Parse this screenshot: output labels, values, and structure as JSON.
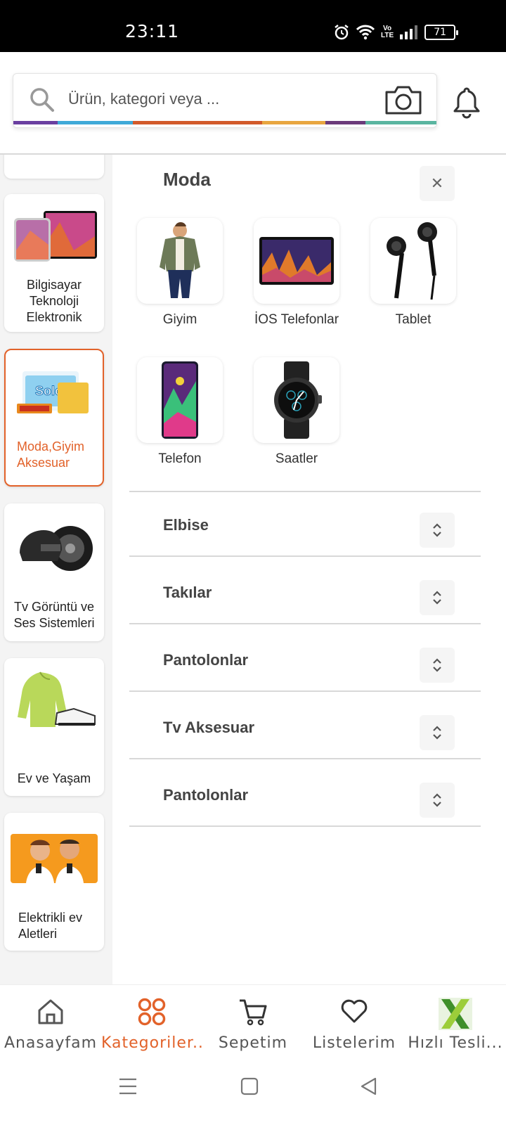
{
  "status_bar": {
    "time": "23:11",
    "battery": "71",
    "network": "Vo LTE"
  },
  "search": {
    "placeholder": "Ürün, kategori veya ..."
  },
  "rainbow_colors": [
    "#6a3fa0",
    "#3fa9d8",
    "#d25a2a",
    "#e8a640",
    "#6b3a7a",
    "#5ab5a0"
  ],
  "sidebar": {
    "items": [
      {
        "label": "Bilgisayar Teknoloji Elektronik",
        "icon": "tablet-phone-image"
      },
      {
        "label": "Moda,Giyim Aksesuar",
        "icon": "tissue-pack-image",
        "active": true
      },
      {
        "label": "Tv Görüntü ve Ses Sistemleri",
        "icon": "helmet-tire-image"
      },
      {
        "label": "Ev ve Yaşam",
        "icon": "jacket-shoes-image"
      },
      {
        "label": "Elektrikli ev Aletleri",
        "icon": "people-phones-image"
      }
    ]
  },
  "panel": {
    "title": "Moda",
    "tiles": [
      {
        "label": "Giyim",
        "icon": "man-jacket-image"
      },
      {
        "label": "İOS Telefonlar",
        "icon": "tablet-image"
      },
      {
        "label": "Tablet",
        "icon": "earphones-image"
      },
      {
        "label": "Telefon",
        "icon": "phone-image"
      },
      {
        "label": "Saatler",
        "icon": "watch-image"
      }
    ],
    "accordions": [
      "Elbise",
      "Takılar",
      "Pantolonlar",
      "Tv Aksesuar",
      "Pantolonlar"
    ]
  },
  "bottom_nav": [
    {
      "label": "Anasayfam",
      "icon": "home-icon"
    },
    {
      "label": "Kategoriler...",
      "icon": "categories-icon",
      "active": true
    },
    {
      "label": "Sepetim",
      "icon": "cart-icon"
    },
    {
      "label": "Listelerim",
      "icon": "heart-icon"
    },
    {
      "label": "Hızlı Tesli...",
      "icon": "x-logo-icon"
    }
  ],
  "colors": {
    "accent": "#e2622a"
  }
}
